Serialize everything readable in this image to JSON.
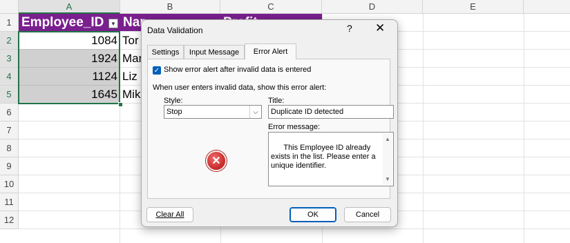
{
  "sheet": {
    "columns": [
      "A",
      "B",
      "C",
      "D",
      "E"
    ],
    "rows": [
      "1",
      "2",
      "3",
      "4",
      "5",
      "6",
      "7",
      "8",
      "9",
      "10",
      "11",
      "12"
    ],
    "header_cells": [
      "Employee_ID",
      "Nar",
      "Profit"
    ],
    "data_rows": [
      {
        "id": "1084",
        "name": "Tor"
      },
      {
        "id": "1924",
        "name": "Mar"
      },
      {
        "id": "1124",
        "name": "Liz"
      },
      {
        "id": "1645",
        "name": "Mik"
      }
    ],
    "filter_icon": "chevron-down-icon",
    "header_color": "#7a1f8e",
    "selection_color": "#217346"
  },
  "dialog": {
    "title": "Data Validation",
    "help": "?",
    "close": "✕",
    "tabs": [
      "Settings",
      "Input Message",
      "Error Alert"
    ],
    "active_tab": "Error Alert",
    "show_alert_checked": true,
    "show_alert_label": "Show error alert after invalid data is entered",
    "instruction": "When user enters invalid data, show this error alert:",
    "style_label": "Style:",
    "style_value": "Stop",
    "title_label": "Title:",
    "title_value": "Duplicate ID detected",
    "message_label": "Error message:",
    "message_value": "This Employee ID already exists in the list. Please enter a unique identifier.",
    "style_icon": "stop-error-icon",
    "buttons": {
      "clear_all": "Clear All",
      "ok": "OK",
      "cancel": "Cancel"
    },
    "accent": "#005fb8"
  }
}
